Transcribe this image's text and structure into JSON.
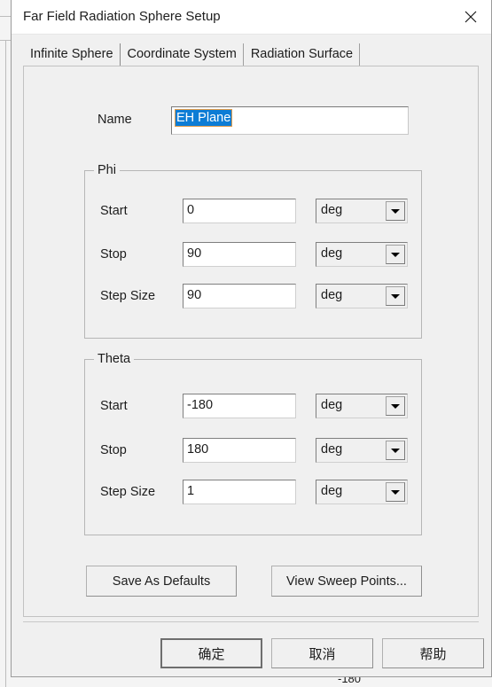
{
  "window": {
    "title": "Far Field Radiation Sphere Setup",
    "close_icon": "close-icon"
  },
  "tabs": [
    {
      "label": "Infinite Sphere",
      "active": true
    },
    {
      "label": "Coordinate System",
      "active": false
    },
    {
      "label": "Radiation Surface",
      "active": false
    }
  ],
  "form": {
    "name_label": "Name",
    "name_value": "EH Plane",
    "name_selected": true
  },
  "groups": [
    {
      "legend": "Phi",
      "rows": [
        {
          "label": "Start",
          "value": "0",
          "unit": "deg"
        },
        {
          "label": "Stop",
          "value": "90",
          "unit": "deg"
        },
        {
          "label": "Step Size",
          "value": "90",
          "unit": "deg"
        }
      ]
    },
    {
      "legend": "Theta",
      "rows": [
        {
          "label": "Start",
          "value": "-180",
          "unit": "deg"
        },
        {
          "label": "Stop",
          "value": "180",
          "unit": "deg"
        },
        {
          "label": "Step Size",
          "value": "1",
          "unit": "deg"
        }
      ]
    }
  ],
  "actions": {
    "save_defaults": "Save As Defaults",
    "view_sweep_points": "View Sweep Points..."
  },
  "footer": {
    "ok": "确定",
    "cancel": "取消",
    "help": "帮助"
  },
  "background": {
    "axis_label": "-180"
  },
  "colors": {
    "dialog_bg": "#f0f0f0",
    "titlebar_bg": "#ffffff",
    "selection_blue": "#0c7cd5",
    "field_bg": "#ffffff",
    "border_gray": "#7f7f7f"
  }
}
